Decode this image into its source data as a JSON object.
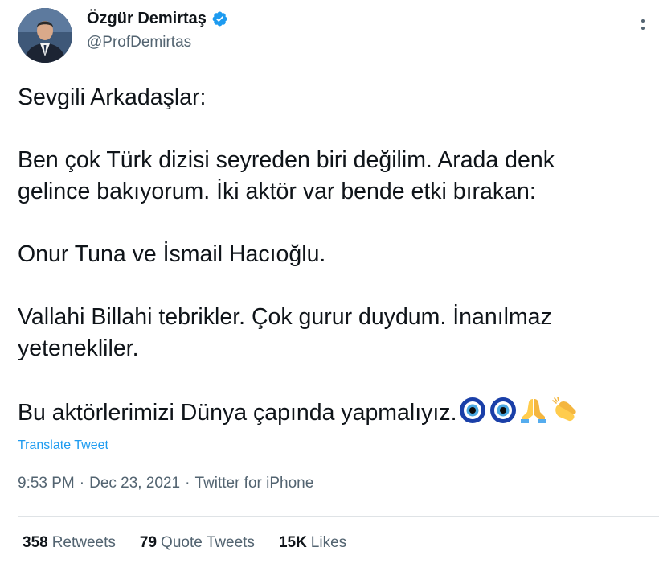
{
  "author": {
    "display_name": "Özgür Demirtaş",
    "handle": "@ProfDemirtas",
    "verified": true,
    "avatar_icon": "profile-photo"
  },
  "tweet": {
    "lines": [
      "Sevgili Arkadaşlar:",
      "",
      "Ben çok Türk dizisi seyreden biri değilim. Arada denk",
      "gelince bakıyorum. İki aktör var bende etki bırakan:",
      "",
      "Onur Tuna ve İsmail Hacıoğlu.",
      "",
      "Vallahi Billahi tebrikler. Çok gurur duydum. İnanılmaz",
      "yetenekliler.",
      "",
      "Bu aktörlerimizi Dünya çapında yapmalıyız."
    ],
    "emojis": [
      "nazar-amulet-icon",
      "nazar-amulet-icon",
      "folded-hands-icon",
      "clapping-hands-icon"
    ]
  },
  "translate_label": "Translate Tweet",
  "meta": {
    "time": "9:53 PM",
    "separator": "·",
    "date": "Dec 23, 2021",
    "source": "Twitter for iPhone"
  },
  "stats": {
    "retweets_count": "358",
    "retweets_label": "Retweets",
    "quotes_count": "79",
    "quotes_label": "Quote Tweets",
    "likes_count": "15K",
    "likes_label": "Likes"
  },
  "colors": {
    "text": "#0f1419",
    "secondary": "#536471",
    "link": "#1d9bf0",
    "verified": "#1d9bf0",
    "divider": "#dfe3e6"
  }
}
